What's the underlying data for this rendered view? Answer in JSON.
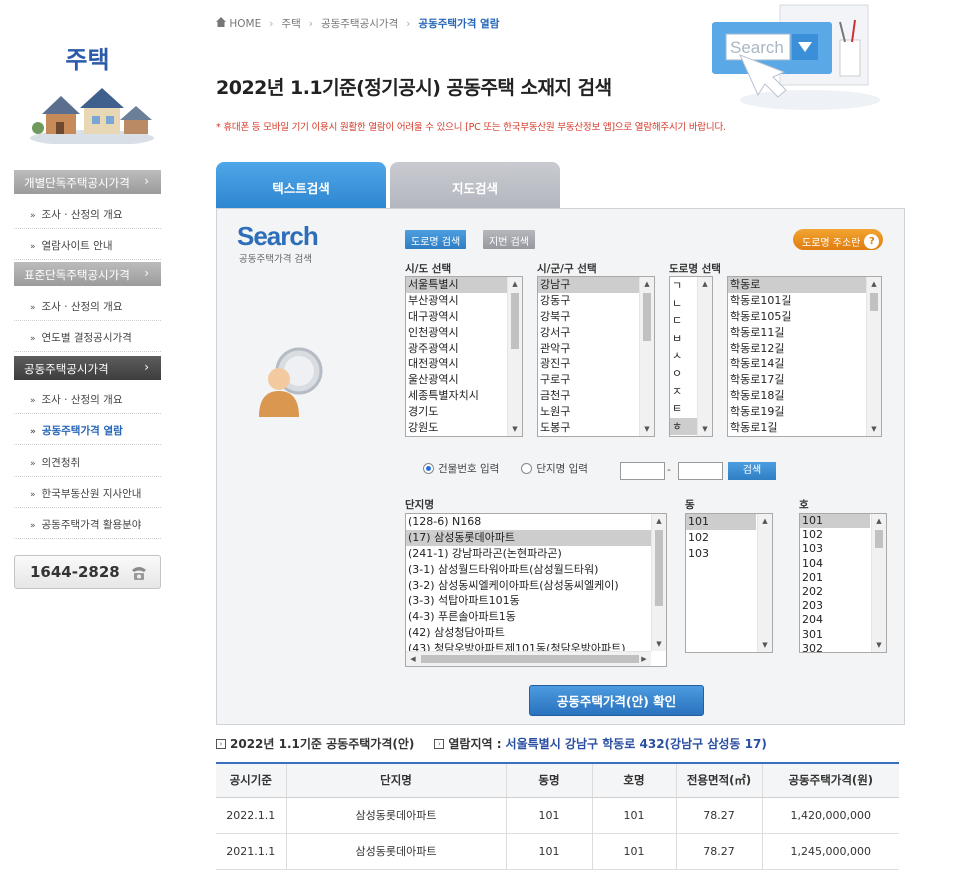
{
  "sidebar": {
    "title": "주택",
    "sections": [
      {
        "label": "개별단독주택공시가격",
        "items": [
          "조사 · 산정의 개요",
          "열람사이트 안내"
        ]
      },
      {
        "label": "표준단독주택공시가격",
        "items": [
          "조사 · 산정의 개요",
          "연도별 결정공시가격"
        ]
      },
      {
        "label": "공동주택공시가격",
        "items": [
          "조사 · 산정의 개요",
          "공동주택가격 열람",
          "의견청취",
          "한국부동산원 지사안내",
          "공동주택가격 활용분야"
        ]
      }
    ],
    "phone": "1644-2828"
  },
  "breadcrumb": [
    "HOME",
    "주택",
    "공동주택공시가격",
    "공동주택가격 열람"
  ],
  "page_title": "2022년 1.1기준(정기공시) 공동주택 소재지 검색",
  "notice": "* 휴대폰 등 모바일 기기 이용시 원활한 열람이 어려울 수 있으니 [PC 또는 한국부동산원 부동산정보 앱]으로 열람해주시기 바랍니다.",
  "search_illustration_text": "Search",
  "tabs": [
    "텍스트검색",
    "지도검색"
  ],
  "panel": {
    "logo": "Search",
    "logo_sub": "공동주택가격 검색",
    "btn_road": "도로명 검색",
    "btn_lot": "지번 검색",
    "btn_help": "도로명 주소란",
    "labels": {
      "sido": "시/도 선택",
      "sigungu": "시/군/구 선택",
      "road": "도로명 선택",
      "complex": "단지명",
      "dong": "동",
      "ho": "호"
    },
    "sido": [
      "서울특별시",
      "부산광역시",
      "대구광역시",
      "인천광역시",
      "광주광역시",
      "대전광역시",
      "울산광역시",
      "세종특별자치시",
      "경기도",
      "강원도"
    ],
    "sigungu": [
      "강남구",
      "강동구",
      "강북구",
      "강서구",
      "관악구",
      "광진구",
      "구로구",
      "금천구",
      "노원구",
      "도봉구"
    ],
    "initials": [
      "ㄱ",
      "ㄴ",
      "ㄷ",
      "ㅂ",
      "ㅅ",
      "ㅇ",
      "ㅈ",
      "ㅌ",
      "ㅎ"
    ],
    "roads": [
      "학동로",
      "학동로101길",
      "학동로105길",
      "학동로11길",
      "학동로12길",
      "학동로14길",
      "학동로17길",
      "학동로18길",
      "학동로19길",
      "학동로1길"
    ],
    "radio_1": "건물번호 입력",
    "radio_2": "단지명 입력",
    "btn_find": "검색",
    "complexes": [
      "(128-6) N168",
      "(17) 삼성동롯데아파트",
      "(241-1) 강남파라곤(논현파라곤)",
      "(3-1) 삼성월드타워아파트(삼성월드타워)",
      "(3-2) 삼성동씨엘케이아파트(삼성동씨엘케이)",
      "(3-3) 석탑아파트101동",
      "(4-3) 푸른솔아파트1동",
      "(42) 삼성청담아파트",
      "(43) 청담우방아파트제101동(청담우방아파트)"
    ],
    "dongs": [
      "101",
      "102",
      "103"
    ],
    "hos": [
      "101",
      "102",
      "103",
      "104",
      "201",
      "202",
      "203",
      "204",
      "301",
      "302"
    ],
    "btn_confirm": "공동주택가격(안) 확인"
  },
  "info": {
    "basis": "2022년 1.1기준 공동주택가격(안)",
    "address_label": "열람지역 :",
    "address": "서울특별시 강남구 학동로 432(강남구 삼성동 17)"
  },
  "table": {
    "headers": [
      "공시기준",
      "단지명",
      "동명",
      "호명",
      "전용면적(㎡)",
      "공동주택가격(원)"
    ],
    "rows": [
      [
        "2022.1.1",
        "삼성동롯데아파트",
        "101",
        "101",
        "78.27",
        "1,420,000,000"
      ],
      [
        "2021.1.1",
        "삼성동롯데아파트",
        "101",
        "101",
        "78.27",
        "1,245,000,000"
      ]
    ]
  }
}
